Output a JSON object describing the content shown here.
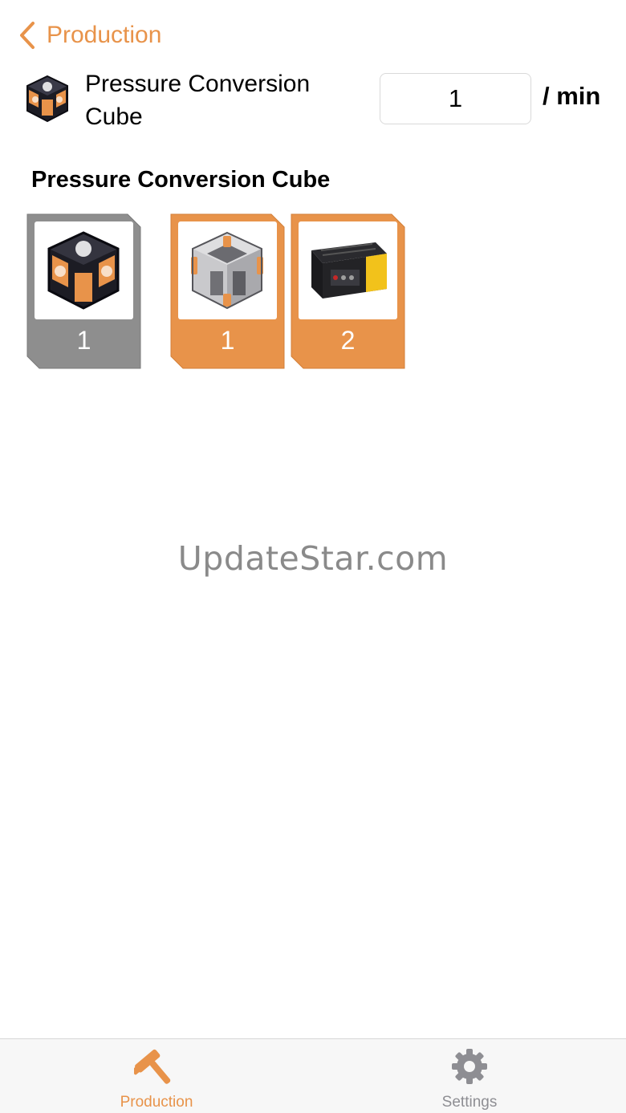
{
  "nav": {
    "back_label": "Production"
  },
  "item": {
    "name": "Pressure Conversion Cube",
    "icon": "pressure-conversion-cube-icon"
  },
  "rate": {
    "value": "1",
    "unit": "/ min"
  },
  "recipe": {
    "title": "Pressure Conversion Cube",
    "components": [
      {
        "name": "pressure-conversion-cube",
        "count": "1",
        "kind": "product"
      },
      {
        "name": "fused-modular-frame",
        "count": "1",
        "kind": "ingredient"
      },
      {
        "name": "radio-control-unit",
        "count": "2",
        "kind": "ingredient"
      }
    ]
  },
  "watermark": "UpdateStar.com",
  "tabs": [
    {
      "label": "Production",
      "icon": "hammer-icon",
      "active": true
    },
    {
      "label": "Settings",
      "icon": "gear-icon",
      "active": false
    }
  ],
  "colors": {
    "accent": "#e8934a",
    "product_card": "#8e8e8e",
    "inactive": "#8e8e93",
    "text": "#000000"
  }
}
